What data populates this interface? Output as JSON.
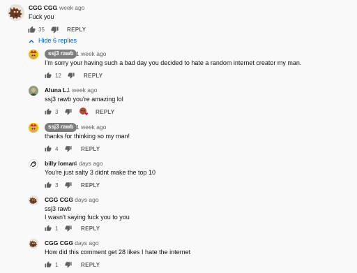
{
  "comment": {
    "author": "CGG CGG",
    "time": "1 week ago",
    "text": "Fuck you",
    "likes": "35",
    "reply_label": "REPLY",
    "avatar_icon": "dog-avatar-icon"
  },
  "toggle": {
    "label": "Hide 6 replies",
    "color": "#065fd4"
  },
  "replies": [
    {
      "author": "ssj3 rawb",
      "creator_chip": true,
      "time": "1 week ago",
      "text": "I'm sorry your having such a bad day you decided to hate a random internet creator my man.",
      "likes": "12",
      "reply_label": "REPLY",
      "avatar_icon": "character-avatar-icon"
    },
    {
      "author": "Aluna L.",
      "creator_chip": false,
      "time": "1 week ago",
      "text": "ssj3 rawb you're amazing lol",
      "likes": "3",
      "reply_label": "REPLY",
      "hearted": true,
      "avatar_icon": "person-avatar-icon"
    },
    {
      "author": "ssj3 rawb",
      "creator_chip": true,
      "time": "1 week ago",
      "text": "thanks for thinking so my man!",
      "likes": "4",
      "reply_label": "REPLY",
      "avatar_icon": "character-avatar-icon"
    },
    {
      "author": "billy loman",
      "creator_chip": false,
      "time": "4 days ago",
      "text": "You're just salty 3 didnt make the top 10",
      "likes": "3",
      "reply_label": "REPLY",
      "avatar_icon": "sketch-avatar-icon"
    },
    {
      "author": "CGG CGG",
      "creator_chip": false,
      "time": "3 days ago",
      "text_line1": "ssj3 rawb",
      "text_line2": "I wasn't saying fuck you to you",
      "likes": "1",
      "reply_label": "REPLY",
      "avatar_icon": "dog-avatar-icon"
    },
    {
      "author": "CGG CGG",
      "creator_chip": false,
      "time": "3 days ago",
      "text": "How did this comment get 28 likes I hate the internet",
      "likes": "1",
      "reply_label": "REPLY",
      "avatar_icon": "dog-avatar-icon"
    }
  ],
  "colors": {
    "background": "#f9f9f9",
    "chip": "#7d7d7d",
    "secondary_text": "#606060"
  }
}
